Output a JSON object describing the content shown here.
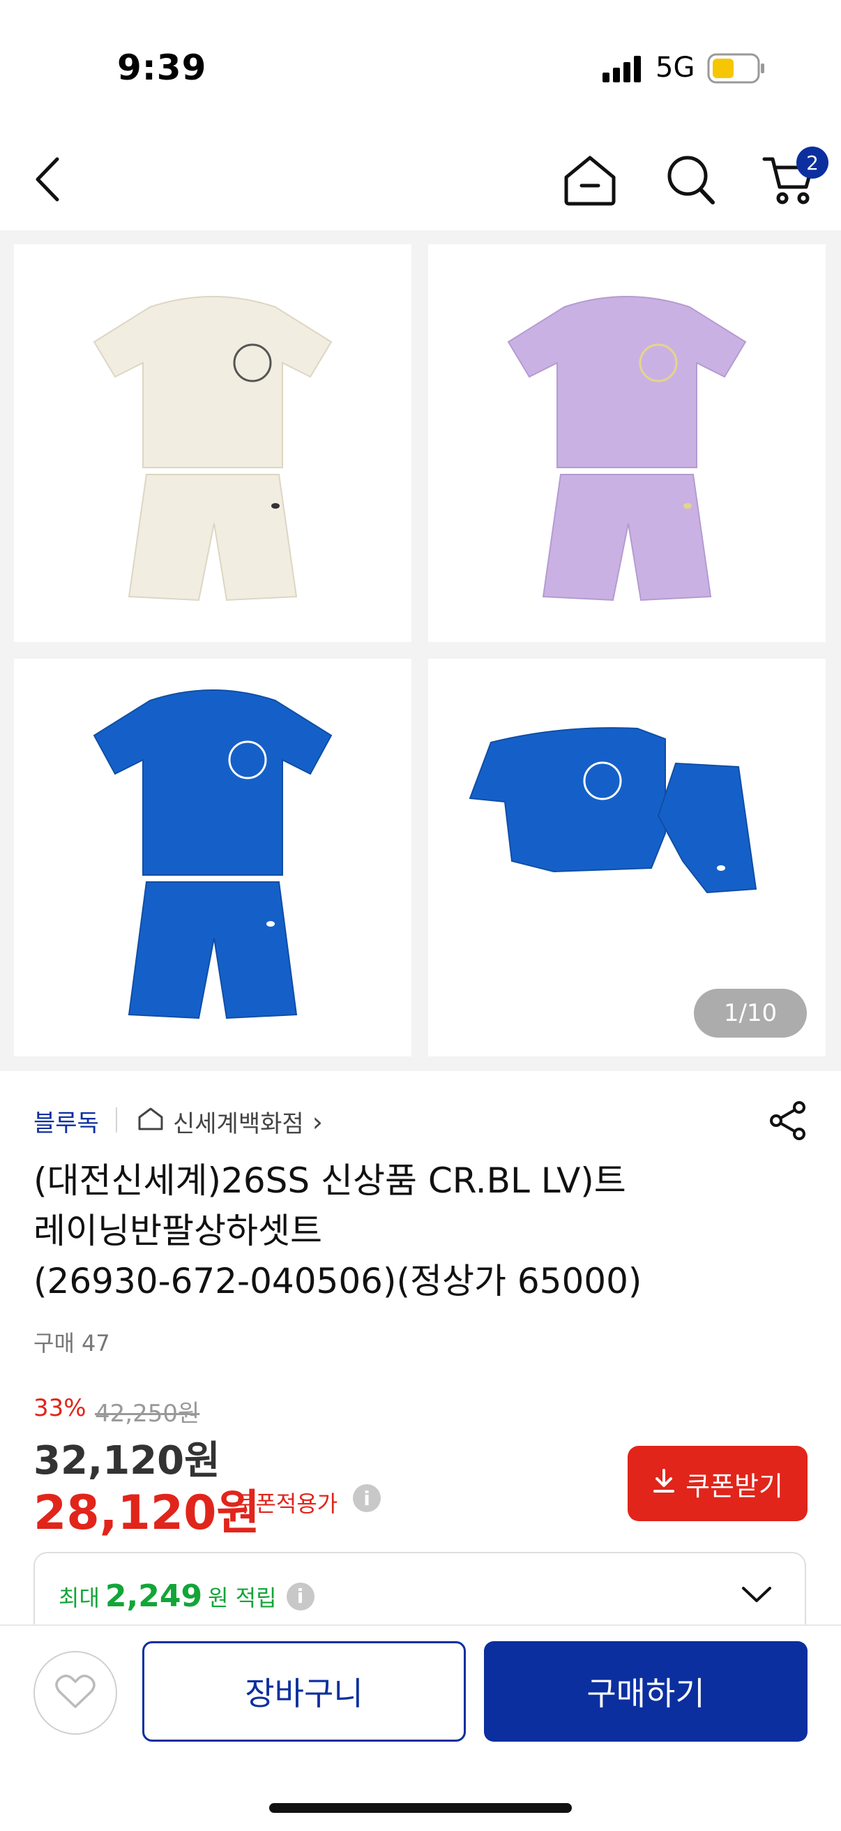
{
  "status_bar": {
    "time": "9:39",
    "network": "5G"
  },
  "nav": {
    "cart_badge": "2",
    "icons": [
      "back-icon",
      "home-icon",
      "search-icon",
      "cart-icon"
    ]
  },
  "gallery": {
    "counter": "1/10"
  },
  "product": {
    "brand": "블루독",
    "store": "신세계백화점",
    "store_chevron": "›",
    "title_lines": [
      "(대전신세계)26SS 신상품  CR.BL LV)트",
      "레이닝반팔상하셋트",
      "(26930-672-040506)(정상가  65000)"
    ],
    "purchase_count": "구매 47",
    "discount": "33%",
    "original_price": "42,250원",
    "price": "32,120원",
    "final_price": "28,120원",
    "final_price_note": "쿠폰적용가",
    "info_glyph": "i",
    "coupon_button": "쿠폰받기",
    "reward": {
      "prefix": "최대",
      "amount": "2,249",
      "suffix": "원 적립"
    }
  },
  "bottom_bar": {
    "cart_label": "장바구니",
    "buy_label": "구매하기"
  },
  "colors": {
    "brand_blue": "#0b2f9f",
    "sale_red": "#e1251b",
    "reward_green": "#13a538"
  }
}
